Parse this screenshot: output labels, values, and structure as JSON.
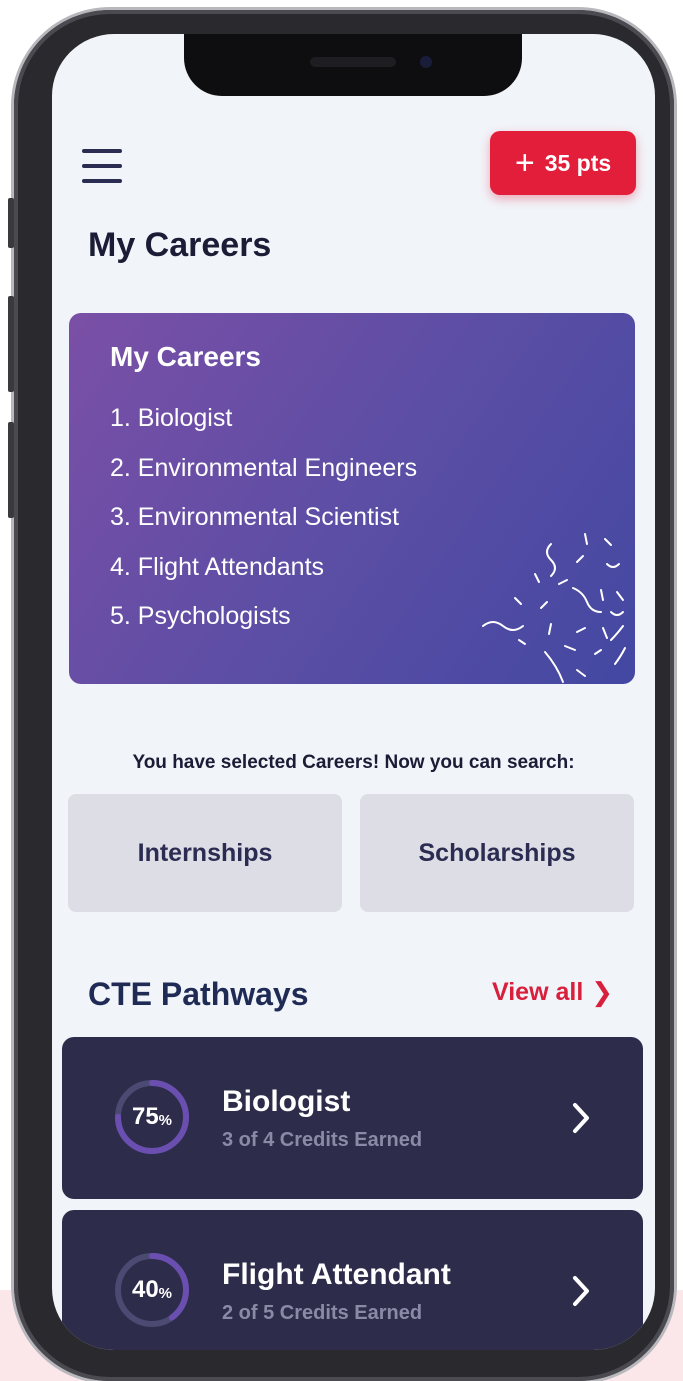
{
  "header": {
    "points_label": "35 pts",
    "page_title": "My Careers"
  },
  "careers_card": {
    "title": "My Careers",
    "items": [
      "1. Biologist",
      "2. Environmental Engineers",
      "3. Environmental Scientist",
      "4. Flight Attendants",
      "5. Psychologists"
    ]
  },
  "search": {
    "note": "You have selected Careers! Now you can search:",
    "internships_label": "Internships",
    "scholarships_label": "Scholarships"
  },
  "pathways": {
    "title": "CTE Pathways",
    "view_all_label": "View all",
    "items": [
      {
        "percent": "75",
        "percent_sign": "%",
        "progress": 0.75,
        "title": "Biologist",
        "subtitle": "3 of 4 Credits Earned"
      },
      {
        "percent": "40",
        "percent_sign": "%",
        "progress": 0.4,
        "title": "Flight Attendant",
        "subtitle": "2 of 5 Credits Earned"
      }
    ]
  },
  "colors": {
    "accent_red": "#e31e3a",
    "card_gradient_start": "#7b4fa6",
    "card_gradient_end": "#4348a2",
    "pathway_bg": "#2d2c4a",
    "ring_progress": "#6a4fb0",
    "ring_track": "#4a4a72"
  },
  "icons": {
    "menu": "hamburger-icon",
    "plus": "plus-icon",
    "view_all": "chevron-right-icon",
    "pathway_arrow": "chevron-right-icon"
  }
}
